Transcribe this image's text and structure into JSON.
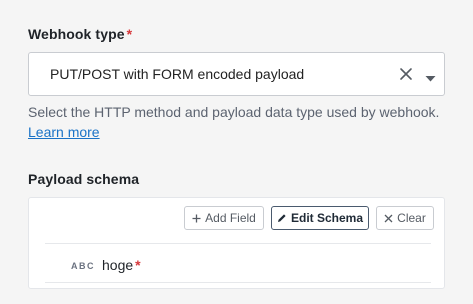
{
  "webhook_type": {
    "label": "Webhook type",
    "required_marker": "*",
    "selected_value": "PUT/POST with FORM encoded payload",
    "help_text": "Select the HTTP method and payload data type used by webhook.",
    "learn_more_label": "Learn more"
  },
  "payload_schema": {
    "label": "Payload schema",
    "toolbar": {
      "add_field_label": "Add Field",
      "edit_schema_label": "Edit Schema",
      "clear_label": "Clear"
    },
    "fields": [
      {
        "type_badge": "ABC",
        "name": "hoge",
        "required_marker": "*"
      }
    ]
  },
  "colors": {
    "required": "#d6383b",
    "link": "#1a73c7",
    "primary_button_border": "#4a5a6e"
  }
}
